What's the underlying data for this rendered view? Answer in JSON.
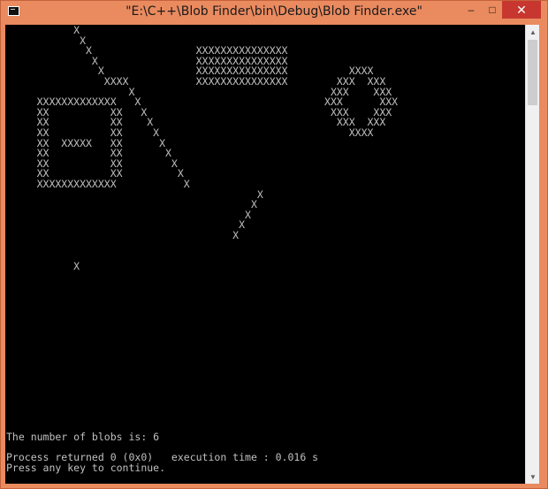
{
  "window": {
    "title": "\"E:\\C++\\Blob Finder\\bin\\Debug\\Blob Finder.exe\"",
    "controls": {
      "minimize": "–",
      "maximize": "□",
      "close": "✕"
    }
  },
  "console": {
    "blob_art": "           X\n            X\n             X                 XXXXXXXXXXXXXXX\n              X                XXXXXXXXXXXXXXX\n               X               XXXXXXXXXXXXXXX          XXXX\n                XXXX           XXXXXXXXXXXXXXX        XXX  XXX\n                    X                                XXX    XXX\n     XXXXXXXXXXXXX   X                              XXX      XXX\n     XX          XX   X                              XXX    XXX\n     XX          XX    X                              XXX  XXX\n     XX          XX     X                               XXXX\n     XX  XXXXX   XX      X\n     XX          XX       X\n     XX          XX        X\n     XX          XX         X\n     XXXXXXXXXXXXX           X\n                                         X\n                                        X\n                                       X\n                                      X\n                                     X\n\n\n           X",
    "blob_count_line": "The number of blobs is: 6",
    "process_line": "Process returned 0 (0x0)   execution time : 0.016 s",
    "continue_line": "Press any key to continue."
  },
  "scrollbar": {
    "up_arrow": "▲",
    "down_arrow": "▼"
  }
}
